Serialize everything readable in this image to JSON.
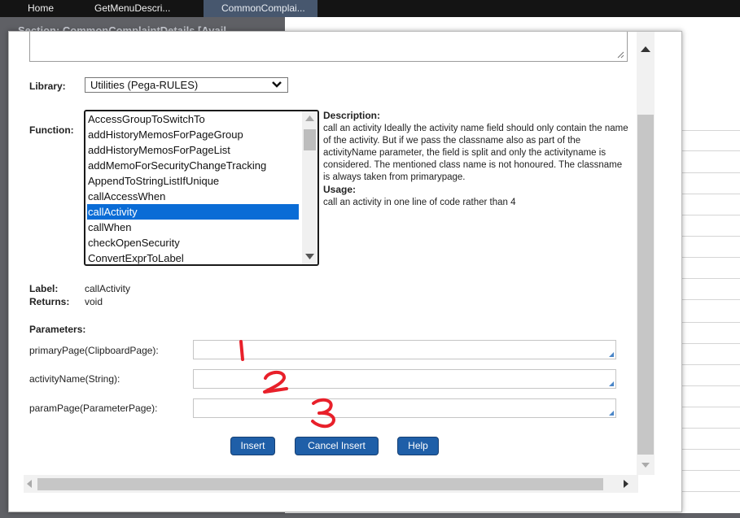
{
  "top_tabs": [
    "Home",
    "GetMenuDescri...",
    "CommonComplai..."
  ],
  "background": {
    "section_title": "Section: CommonComplaintDetails [Avail"
  },
  "library": {
    "label": "Library:",
    "selected": "Utilities (Pega-RULES)"
  },
  "function": {
    "label": "Function:",
    "options": [
      "AccessGroupToSwitchTo",
      "addHistoryMemosForPageGroup",
      "addHistoryMemosForPageList",
      "addMemoForSecurityChangeTracking",
      "AppendToStringListIfUnique",
      "callAccessWhen",
      "callActivity",
      "callWhen",
      "checkOpenSecurity",
      "ConvertExprToLabel"
    ],
    "selected_index": 6
  },
  "description": {
    "heading": "Description:",
    "text": "call an activity Ideally the activity name field should only contain the name of the activity. But if we pass the classname also as part of the activityName parameter, the field is split and only the activityname is considered. The mentioned class name is not honoured. The classname is always taken from primarypage.",
    "usage_heading": "Usage:",
    "usage_text": "call an activity in one line of code rather than 4"
  },
  "meta": {
    "label_key": "Label:",
    "label_value": "callActivity",
    "returns_key": "Returns:",
    "returns_value": "void"
  },
  "parameters": {
    "heading": "Parameters:",
    "items": [
      {
        "label": "primaryPage(ClipboardPage):",
        "value": ""
      },
      {
        "label": "activityName(String):",
        "value": ""
      },
      {
        "label": "paramPage(ParameterPage):",
        "value": ""
      }
    ]
  },
  "buttons": {
    "insert": "Insert",
    "cancel_insert": "Cancel Insert",
    "help": "Help"
  },
  "annotations": [
    "1",
    "2",
    "3"
  ],
  "colors": {
    "selected_row": "#0a6cd6",
    "button": "#1f5fa8",
    "annotation": "#e8202a"
  }
}
